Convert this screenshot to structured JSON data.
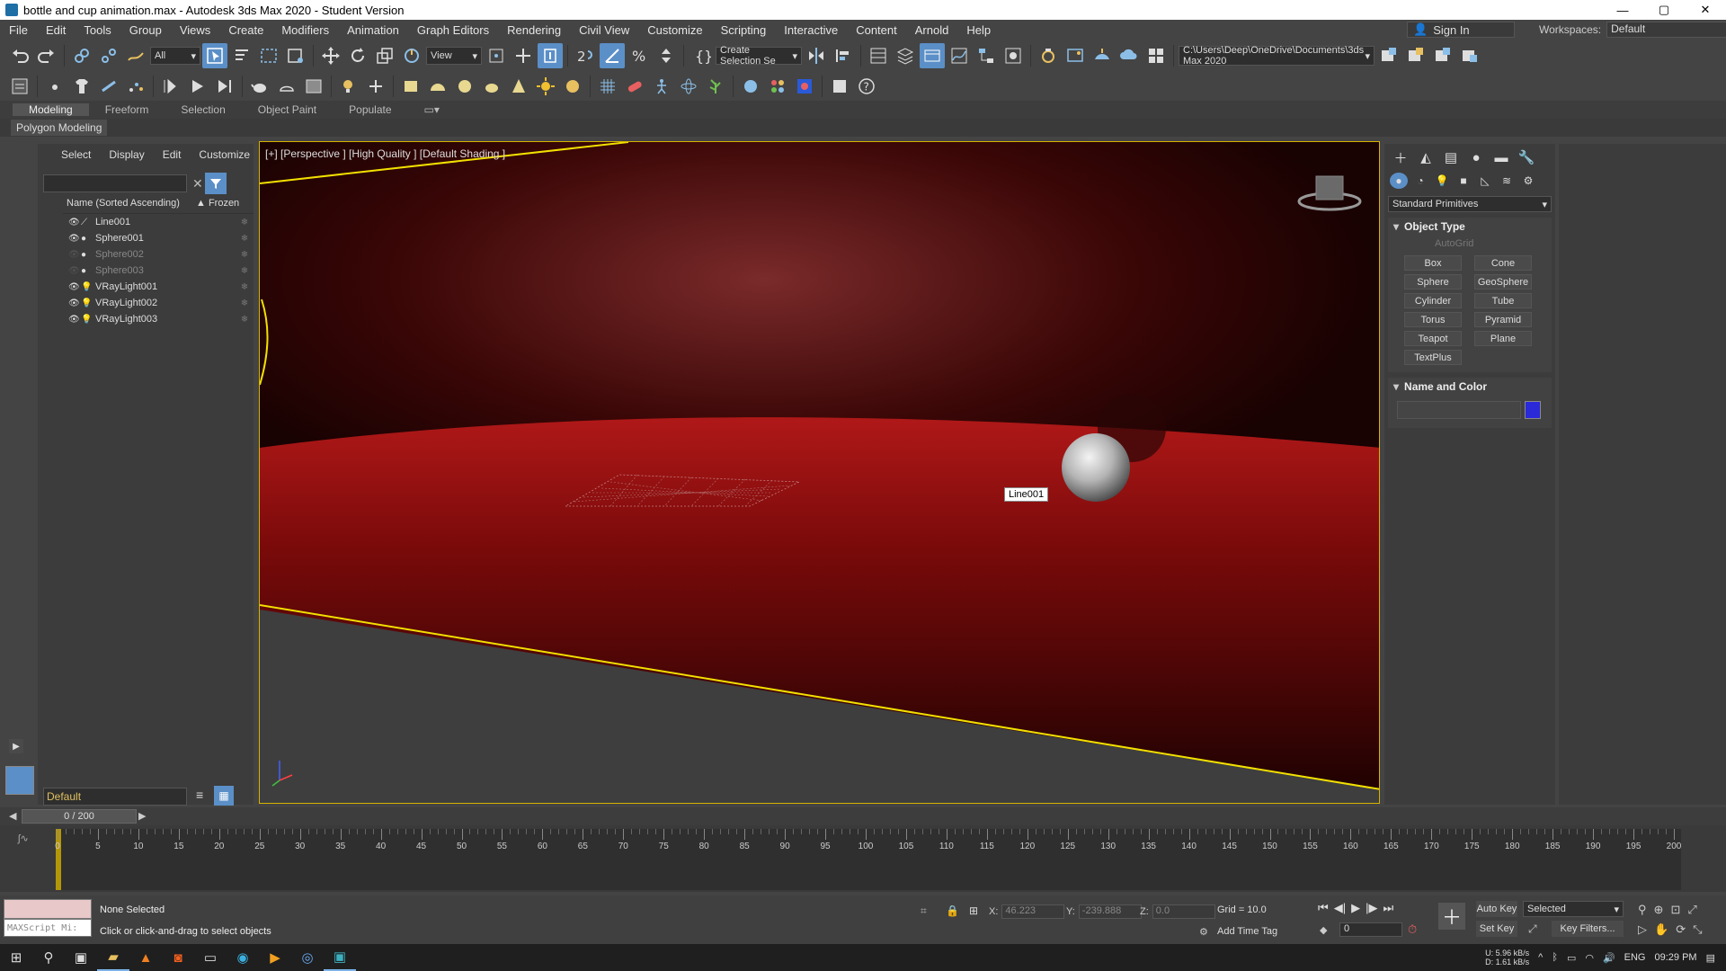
{
  "window": {
    "title": "bottle and cup animation.max - Autodesk 3ds Max 2020 - Student Version",
    "min": "—",
    "max": "▢",
    "close": "✕"
  },
  "menu": [
    "File",
    "Edit",
    "Tools",
    "Group",
    "Views",
    "Create",
    "Modifiers",
    "Animation",
    "Graph Editors",
    "Rendering",
    "Civil View",
    "Customize",
    "Scripting",
    "Interactive",
    "Content",
    "Arnold",
    "Help"
  ],
  "signin": {
    "label": "Sign In"
  },
  "workspace": {
    "label": "Workspaces:",
    "value": "Default"
  },
  "toolbar": {
    "filter": "All",
    "refcoord": "View",
    "selection_set": "Create Selection Se",
    "project_path": "C:\\Users\\Deep\\OneDrive\\Documents\\3ds Max 2020"
  },
  "ribbon": {
    "tabs": [
      "Modeling",
      "Freeform",
      "Selection",
      "Object Paint",
      "Populate"
    ],
    "active": "Modeling",
    "subpanel": "Polygon Modeling"
  },
  "explorer": {
    "tabs": [
      "Select",
      "Display",
      "Edit",
      "Customize"
    ],
    "col_name": "Name (Sorted Ascending)",
    "col_frozen": "▲ Frozen",
    "items": [
      {
        "name": "Line001",
        "type": "line",
        "hidden": false
      },
      {
        "name": "Sphere001",
        "type": "sphere",
        "hidden": false
      },
      {
        "name": "Sphere002",
        "type": "sphere",
        "hidden": true
      },
      {
        "name": "Sphere003",
        "type": "sphere",
        "hidden": true
      },
      {
        "name": "VRayLight001",
        "type": "light",
        "hidden": false
      },
      {
        "name": "VRayLight002",
        "type": "light",
        "hidden": false
      },
      {
        "name": "VRayLight003",
        "type": "light",
        "hidden": false
      }
    ],
    "layer": "Default"
  },
  "viewport": {
    "label": "[+] [Perspective ] [High Quality ] [Default Shading ]",
    "tooltip": "Line001"
  },
  "command_panel": {
    "category": "Standard Primitives",
    "object_type_title": "Object Type",
    "autogrid": "AutoGrid",
    "buttons": [
      "Box",
      "Cone",
      "Sphere",
      "GeoSphere",
      "Cylinder",
      "Tube",
      "Torus",
      "Pyramid",
      "Teapot",
      "Plane",
      "TextPlus"
    ],
    "name_color_title": "Name and Color",
    "color": "#2a2ad8"
  },
  "timeslider": {
    "value": "0 / 200"
  },
  "trackbar": {
    "ticks": [
      0,
      5,
      10,
      15,
      20,
      25,
      30,
      35,
      40,
      45,
      50,
      55,
      60,
      65,
      70,
      75,
      80,
      85,
      90,
      95,
      100,
      105,
      110,
      115,
      120,
      125,
      130,
      135,
      140,
      145,
      150,
      155,
      160,
      165,
      170,
      175,
      180,
      185,
      190,
      195,
      200
    ]
  },
  "status": {
    "maxscript": "MAXScript Mi:",
    "selection": "None Selected",
    "prompt": "Click or click-and-drag to select objects",
    "x_label": "X:",
    "x": "46.223",
    "y_label": "Y:",
    "y": "-239.888",
    "z_label": "Z:",
    "z": "0.0",
    "grid": "Grid = 10.0",
    "add_time_tag": "Add Time Tag",
    "frame": "0",
    "auto_key": "Auto Key",
    "set_key": "Set Key",
    "key_mode": "Selected",
    "key_filters": "Key Filters..."
  },
  "taskbar": {
    "lang": "ENG",
    "time": "09:29 PM",
    "net_up": "5.96 kB/s",
    "net_down": "1.61 kB/s",
    "net_u": "U:",
    "net_d": "D:"
  }
}
